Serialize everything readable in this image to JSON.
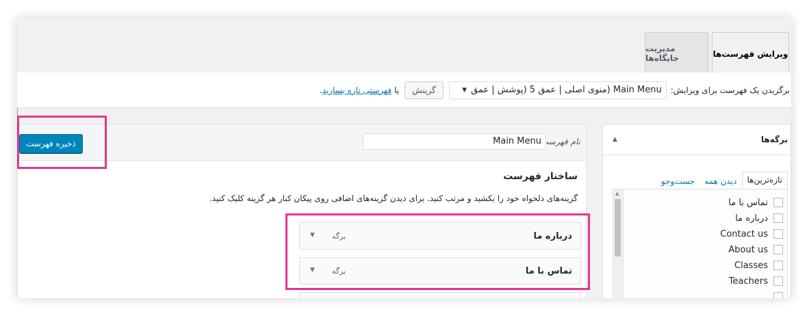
{
  "tabs": {
    "edit_menus": "ویرایش فهرست‌ها",
    "manage_locations": "مدیریت جایگاه‌ها"
  },
  "selection": {
    "label": "برگزیدن یک فهرست برای ویرایش:",
    "selected_menu": "Main Menu (منوی اصلی | عمق 5 (پوشش | عمق",
    "select_button": "گزینش",
    "or_text": "یا",
    "create_link": "فهرستی تازه بسازید",
    "trailing": "."
  },
  "pages_box": {
    "title": "برگه‌ها",
    "subtabs": [
      "تازه‌ترین‌ها",
      "دیدن همه",
      "جست‌وجو"
    ],
    "items": [
      "تماس با ما",
      "درباره ما",
      "Contact us",
      "About us",
      "Classes",
      "Teachers"
    ]
  },
  "menu": {
    "name_label": "نام فهرست",
    "name_value": "Main Menu",
    "save_button": "ذخیره فهرست",
    "structure_title": "ساختار فهرست",
    "instructions": "گزینه‌های دلخواه خود را بکشید و مرتب کنید. برای دیدن گزینه‌های اضافی روی پیکان کنار هر گزینه کلیک کنید.",
    "items": [
      {
        "title": "درباره ما",
        "type": "برگه"
      },
      {
        "title": "تماس با ما",
        "type": "برگه"
      }
    ]
  },
  "colors": {
    "primary_button": "#0085ba",
    "highlight": "#e3358f",
    "link": "#0073aa"
  }
}
